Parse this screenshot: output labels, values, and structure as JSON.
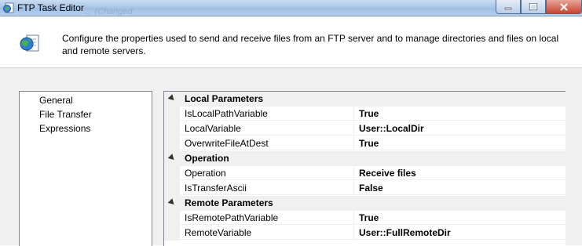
{
  "window": {
    "title": "FTP Task Editor",
    "background_text": "... (Changed"
  },
  "header": {
    "description": "Configure the properties used to send and receive files from an FTP server and to manage directories and files on local and remote servers."
  },
  "nav": {
    "items": [
      {
        "label": "General"
      },
      {
        "label": "File Transfer"
      },
      {
        "label": "Expressions"
      }
    ],
    "selected": "File Transfer"
  },
  "grid": {
    "categories": [
      {
        "label": "Local Parameters",
        "properties": [
          {
            "name": "IsLocalPathVariable",
            "value": "True"
          },
          {
            "name": "LocalVariable",
            "value": "User::LocalDir"
          },
          {
            "name": "OverwriteFileAtDest",
            "value": "True"
          }
        ]
      },
      {
        "label": "Operation",
        "properties": [
          {
            "name": "Operation",
            "value": "Receive files"
          },
          {
            "name": "IsTransferAscii",
            "value": "False"
          }
        ]
      },
      {
        "label": "Remote Parameters",
        "properties": [
          {
            "name": "IsRemotePathVariable",
            "value": "True"
          },
          {
            "name": "RemoteVariable",
            "value": "User::FullRemoteDir"
          }
        ]
      }
    ]
  },
  "icons": {
    "app": "ftp-task-icon",
    "header": "globe-document-icon",
    "minimize": "minimize-icon",
    "maximize": "maximize-icon",
    "close": "close-icon"
  }
}
